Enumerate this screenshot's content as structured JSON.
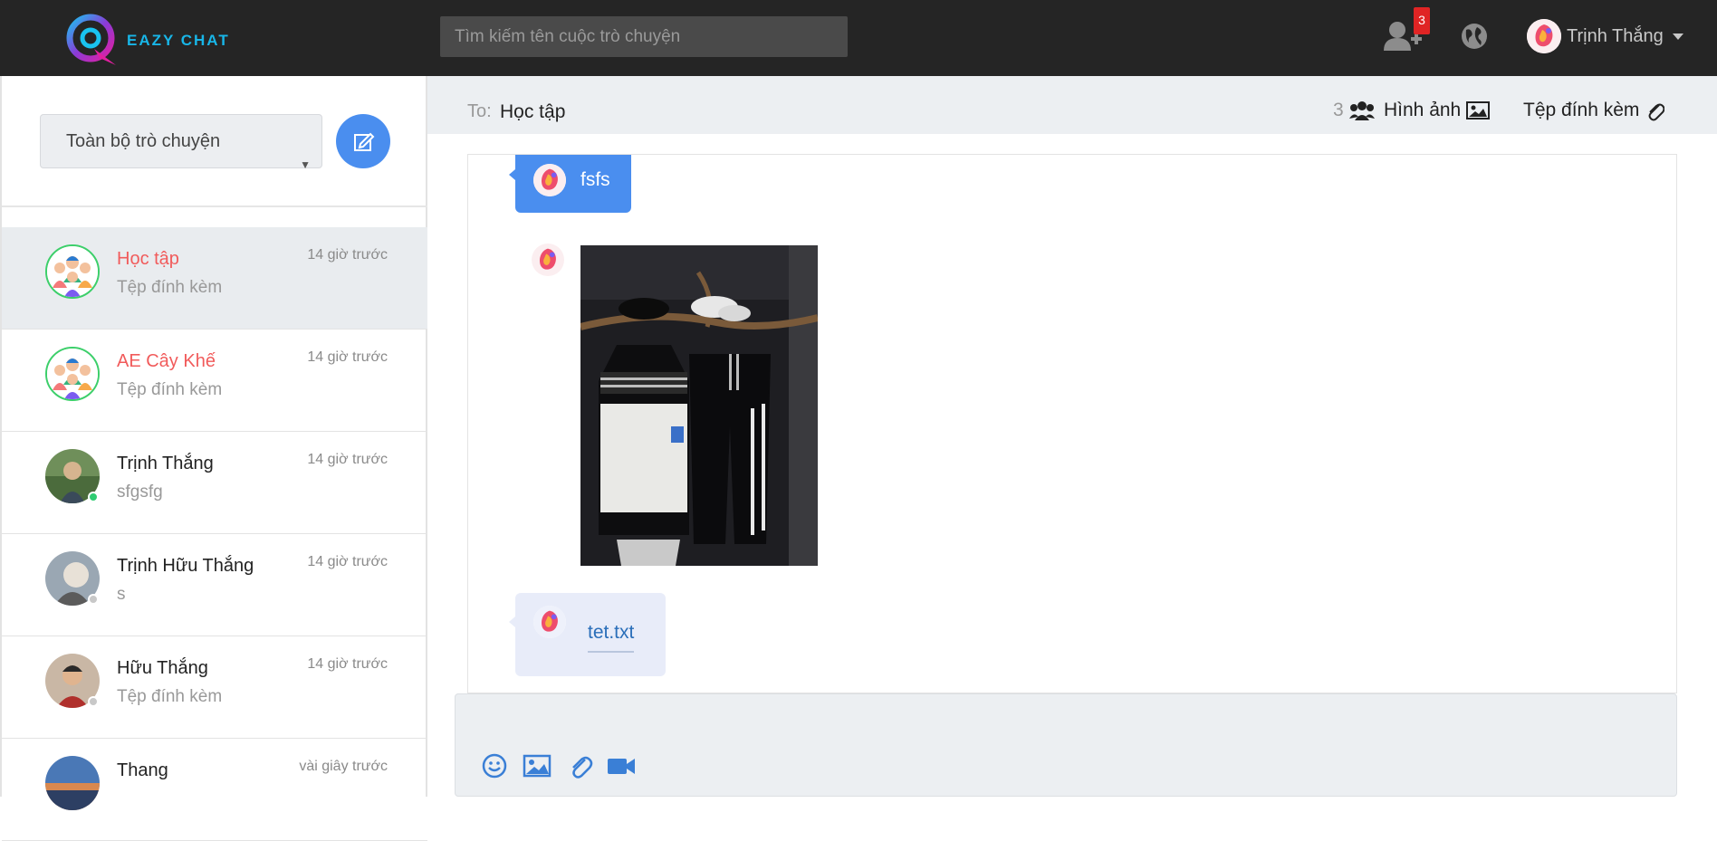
{
  "app": {
    "logo_text": "EAZY CHAT",
    "search_placeholder": "Tìm kiếm tên cuộc trò chuyện",
    "friend_request_count": "3",
    "user_name": "Trịnh Thắng"
  },
  "sidebar": {
    "filter_label": "Toàn bộ trò chuyện",
    "conversations": [
      {
        "name": "Học tập",
        "preview": "Tệp đính kèm",
        "time": "14 giờ trước",
        "type": "group",
        "active": true
      },
      {
        "name": "AE Cây Khế",
        "preview": "Tệp đính kèm",
        "time": "14 giờ trước",
        "type": "group"
      },
      {
        "name": "Trịnh Thắng",
        "preview": "sfgsfg",
        "time": "14 giờ trước",
        "status": "online"
      },
      {
        "name": "Trịnh Hữu Thắng",
        "preview": "s",
        "time": "14 giờ trước",
        "status": "offline"
      },
      {
        "name": "Hữu Thắng",
        "preview": "Tệp đính kèm",
        "time": "14 giờ trước",
        "status": "offline"
      },
      {
        "name": "Thang",
        "preview": "",
        "time": "vài giây trước"
      }
    ]
  },
  "chat": {
    "to_label": "To:",
    "to_name": "Học tập",
    "member_count": "3",
    "images_label": "Hình ảnh",
    "attachments_label": "Tệp đính kèm",
    "messages": {
      "text_message": "fsfs",
      "file_name": "tet.txt"
    }
  },
  "colors": {
    "topbar": "#252525",
    "accent": "#4a8eef",
    "group_name": "#f15b5b",
    "online": "#2ecc71",
    "offline": "#c8c8c8"
  }
}
